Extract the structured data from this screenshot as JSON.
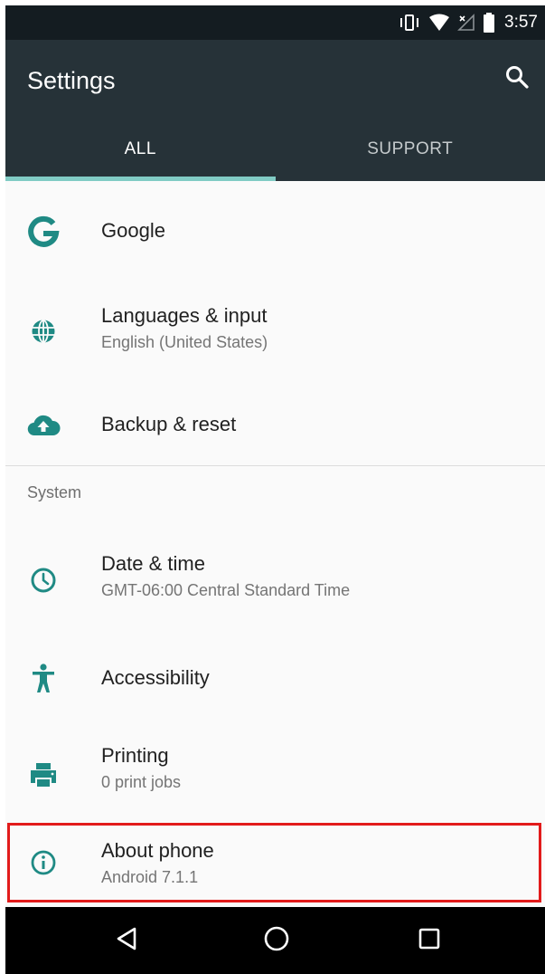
{
  "status_bar": {
    "time": "3:57",
    "icons": [
      "vibrate-icon",
      "wifi-icon",
      "no-signal-icon",
      "battery-icon"
    ]
  },
  "app_bar": {
    "title": "Settings",
    "search_icon": "search-icon"
  },
  "tabs": [
    {
      "label": "ALL",
      "selected": true
    },
    {
      "label": "SUPPORT",
      "selected": false
    }
  ],
  "settings": {
    "items": [
      {
        "title": "Google",
        "subtitle": "",
        "icon": "google-icon"
      },
      {
        "title": "Languages & input",
        "subtitle": "English (United States)",
        "icon": "globe-icon"
      },
      {
        "title": "Backup & reset",
        "subtitle": "",
        "icon": "cloud-upload-icon"
      }
    ],
    "system_header": "System",
    "system_items": [
      {
        "title": "Date & time",
        "subtitle": "GMT-06:00 Central Standard Time",
        "icon": "clock-icon"
      },
      {
        "title": "Accessibility",
        "subtitle": "",
        "icon": "accessibility-icon"
      },
      {
        "title": "Printing",
        "subtitle": "0 print jobs",
        "icon": "printer-icon"
      },
      {
        "title": "About phone",
        "subtitle": "Android 7.1.1",
        "icon": "info-icon"
      }
    ]
  },
  "nav_bar": {
    "buttons": [
      "back-icon",
      "home-icon",
      "recents-icon"
    ]
  },
  "colors": {
    "status_bar": "#141c21",
    "app_bar": "#263238",
    "accent": "#80cbc4",
    "icon_teal": "#1f8a84",
    "highlight_border": "#e21b1b",
    "background": "#fafafa"
  }
}
